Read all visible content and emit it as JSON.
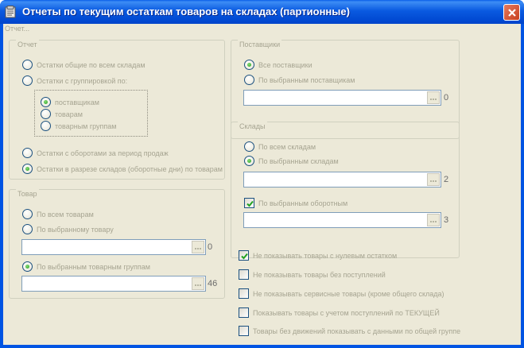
{
  "window": {
    "title": "Отчеты по текущим остаткам товаров на складах (партионные)",
    "menu_item": "Отчет..."
  },
  "report_group": {
    "title": "Отчет",
    "options": [
      {
        "label": "Остатки общие по всем складам",
        "selected": false
      },
      {
        "label": "Остатки с группировкой по:",
        "selected": false
      },
      {
        "label": "Остатки с оборотами за период продаж",
        "selected": false
      },
      {
        "label": "Остатки в разрезе складов (оборотные дни) по товарам",
        "selected": true
      }
    ],
    "grouping": [
      {
        "label": "поставщикам",
        "selected": true
      },
      {
        "label": "товарам",
        "selected": false
      },
      {
        "label": "товарным группам",
        "selected": false
      }
    ]
  },
  "goods_group": {
    "title": "Товар",
    "options": [
      {
        "label": "По всем товарам",
        "selected": false
      },
      {
        "label": "По выбранному товару",
        "selected": false
      },
      {
        "label": "По выбранным товарным группам",
        "selected": true
      }
    ],
    "field1_count": "0",
    "field2_count": "46"
  },
  "supplier_group": {
    "title": "Поставщики",
    "options": [
      {
        "label": "Все поставщики",
        "selected": true
      },
      {
        "label": "По выбранным поставщикам",
        "selected": false
      }
    ],
    "field_count": "0"
  },
  "warehouse_group": {
    "title": "Склады",
    "options": [
      {
        "label": "По всем складам",
        "selected": false
      },
      {
        "label": "По выбранным складам",
        "selected": true
      }
    ],
    "field1_count": "2",
    "extra_check": {
      "label": "По выбранным оборотным",
      "checked": true
    },
    "field2_count": "3"
  },
  "bottom_checks": [
    {
      "label": "Не показывать товары с нулевым остатком",
      "checked": true
    },
    {
      "label": "Не показывать товары без поступлений",
      "checked": false
    },
    {
      "label": "Не показывать сервисные товары (кроме общего склада)",
      "checked": false
    },
    {
      "label": "Показывать товары с учетом поступлений по ТЕКУЩЕЙ",
      "checked": false
    },
    {
      "label": "Товары без движений показывать с данными по общей группе",
      "checked": false
    }
  ],
  "colors": {
    "titlebar": "#0054e3",
    "client_bg": "#ece9d8",
    "disabled_text": "#a6a491",
    "radio_on": "#21a121",
    "close_button": "#c8401f"
  }
}
